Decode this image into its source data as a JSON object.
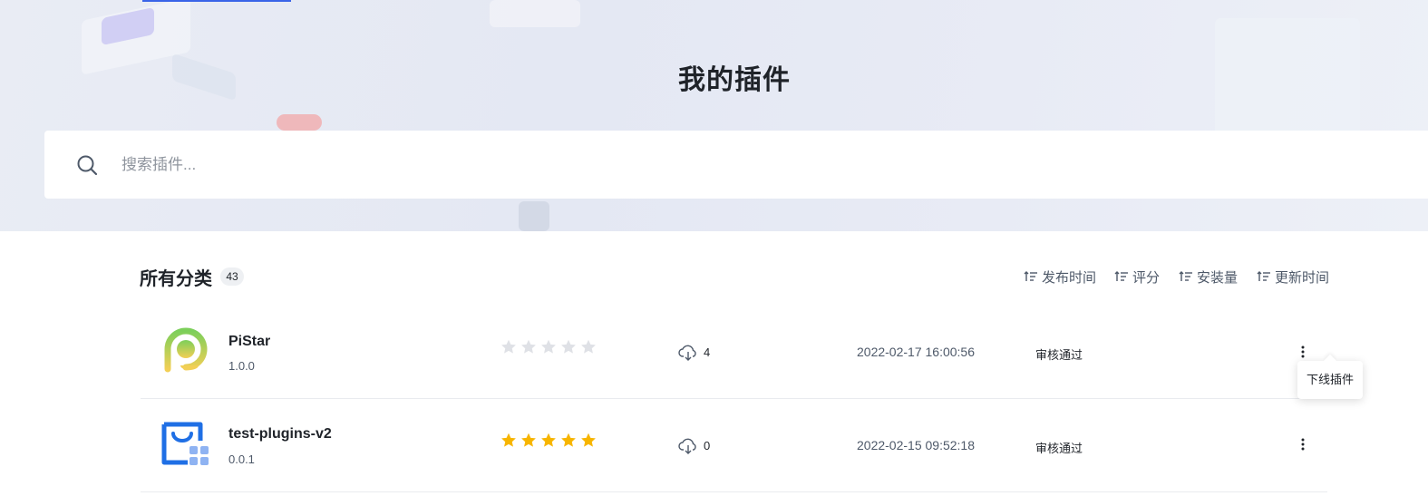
{
  "hero": {
    "title": "我的插件"
  },
  "search": {
    "placeholder": "搜索插件...",
    "icon": "search-icon"
  },
  "category": {
    "title": "所有分类",
    "count": "43"
  },
  "sort": {
    "items": [
      {
        "label": "发布时间",
        "icon": "sort-icon"
      },
      {
        "label": "评分",
        "icon": "sort-icon"
      },
      {
        "label": "安装量",
        "icon": "sort-icon"
      },
      {
        "label": "更新时间",
        "icon": "sort-icon"
      }
    ]
  },
  "plugins": [
    {
      "name": "PiStar",
      "version": "1.0.0",
      "rating": 0,
      "downloads": "4",
      "date": "2022-02-17 16:00:56",
      "status": "审核通过",
      "logo": "pistar-logo"
    },
    {
      "name": "test-plugins-v2",
      "version": "0.0.1",
      "rating": 5,
      "downloads": "0",
      "date": "2022-02-15 09:52:18",
      "status": "审核通过",
      "logo": "plugin-box-logo"
    }
  ],
  "tooltip": {
    "label": "下线插件"
  },
  "colors": {
    "star_filled": "#f7b500",
    "star_empty": "#dfe1e6",
    "accent": "#3a64e8"
  }
}
